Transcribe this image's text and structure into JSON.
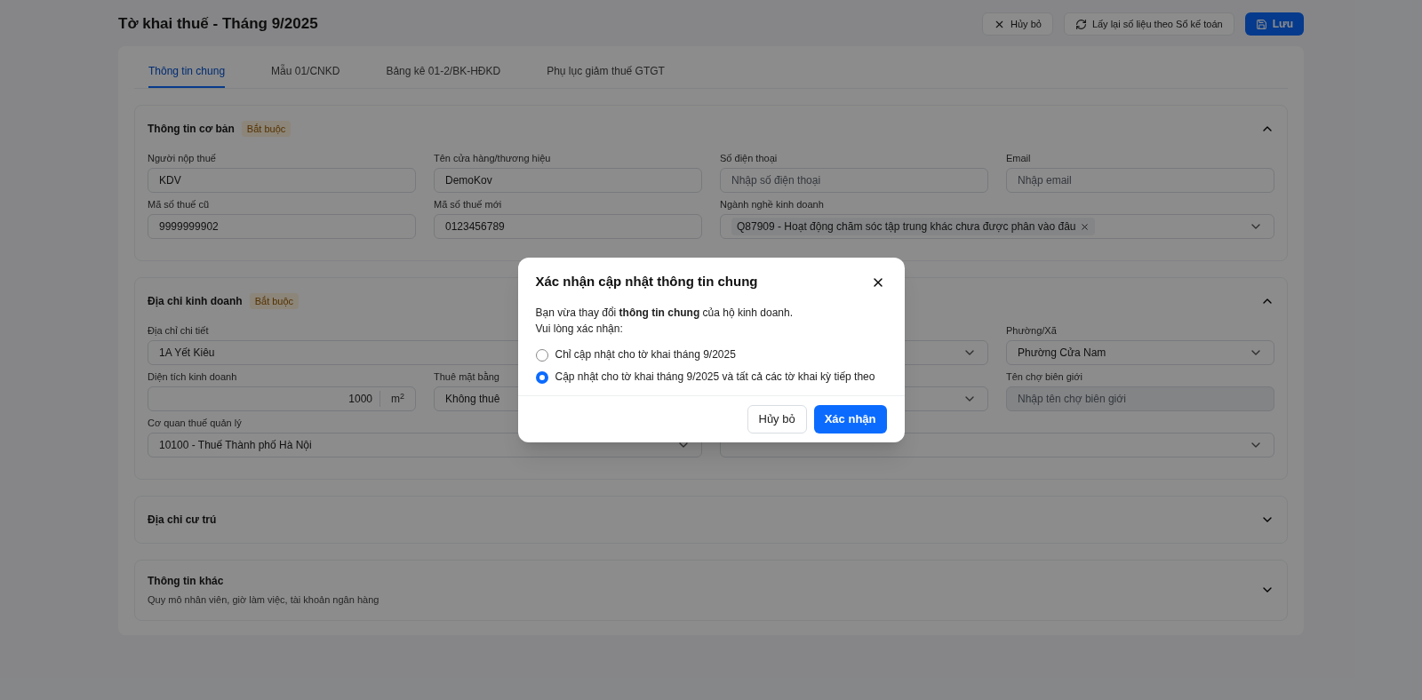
{
  "header": {
    "title": "Tờ khai thuế - Tháng 9/2025",
    "buttons": [
      {
        "kind": "cancel",
        "label": "Hủy bỏ"
      },
      {
        "kind": "reload",
        "label": "Lấy lại số liệu theo Sổ kế toán"
      },
      {
        "kind": "save",
        "label": "Lưu"
      }
    ]
  },
  "tabs": [
    {
      "label": "Thông tin chung",
      "selected": true
    },
    {
      "label": "Mẫu 01/CNKD",
      "selected": false
    },
    {
      "label": "Bảng kê 01-2/BK-HĐKD",
      "selected": false
    },
    {
      "label": "Phụ lục giảm thuế GTGT",
      "selected": false
    }
  ],
  "sections": [
    {
      "title": "Thông tin cơ bản",
      "badge": "Bắt buộc",
      "expanded": true,
      "fields": [
        {
          "kind": "text",
          "label": "Người nộp thuế",
          "value": "KDV"
        },
        {
          "kind": "text",
          "label": "Tên cửa hàng/thương hiệu",
          "value": "DemoKov"
        },
        {
          "kind": "text",
          "label": "Số điện thoại",
          "placeholder": "Nhập số điện thoại"
        },
        {
          "kind": "text",
          "label": "Email",
          "placeholder": "Nhập email"
        },
        {
          "kind": "text",
          "label": "Mã số thuế cũ",
          "value": "9999999902"
        },
        {
          "kind": "text",
          "label": "Mã số thuế mới",
          "value": "0123456789"
        },
        {
          "kind": "tags",
          "label": "Ngành nghề kinh doanh",
          "wide": true,
          "tags": [
            "Q87909 - Hoạt động chăm sóc tập trung khác chưa được phân vào đâu"
          ]
        }
      ]
    },
    {
      "title": "Địa chỉ kinh doanh",
      "badge": "Bắt buộc",
      "expanded": true,
      "fields": [
        {
          "kind": "text",
          "label": "Địa chỉ chi tiết",
          "value": "1A Yết Kiêu",
          "wide": true
        },
        {
          "kind": "select"
        },
        {
          "kind": "select",
          "label": "Phường/Xã",
          "value": "Phường Cửa Nam"
        },
        {
          "kind": "unit",
          "label": "Diện tích kinh doanh",
          "value": "1000",
          "unit": "m$^{2}$"
        },
        {
          "kind": "text",
          "label": "Thuê mặt bằng",
          "value": "Không thuê"
        },
        {
          "kind": "select"
        },
        {
          "kind": "text",
          "label": "Tên chợ biên giới",
          "placeholder": "Nhập tên chợ biên giới",
          "disabled": true
        },
        {
          "kind": "select",
          "label": "Cơ quan thuế quản lý",
          "value": "10100 - Thuế Thành phố Hà Nội",
          "wide": true
        },
        {
          "kind": "select",
          "wide": true
        }
      ]
    },
    {
      "title": "Địa chỉ cư trú",
      "expanded": false
    },
    {
      "title": "Thông tin khác",
      "subtitle": "Quy mô nhân viên, giờ làm việc, tài khoản ngân hàng",
      "expanded": false
    }
  ],
  "dialog": {
    "title": "Xác nhận cập nhật thông tin chung",
    "message": "Bạn vừa thay đổi **thông tin chung** của hộ kinh doanh.",
    "prompt": "Vui lòng xác nhận:",
    "options": [
      {
        "label": "Chỉ cập nhật cho tờ khai tháng 9/2025",
        "selected": false
      },
      {
        "label": "Cập nhật cho tờ khai tháng 9/2025 và tất cả các tờ khai kỳ tiếp theo",
        "selected": true
      }
    ],
    "buttons": [
      {
        "kind": "secondary",
        "label": "Hủy bỏ"
      },
      {
        "kind": "primary",
        "label": "Xác nhận"
      }
    ]
  }
}
